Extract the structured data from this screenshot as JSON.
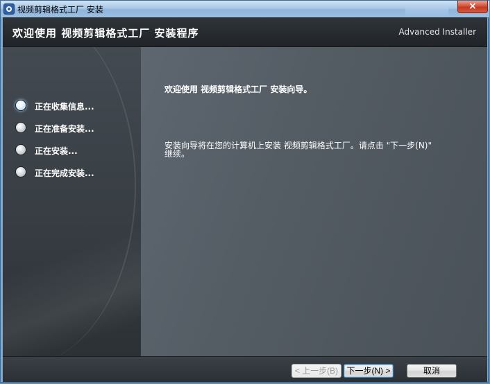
{
  "window": {
    "title": "视频剪辑格式工厂 安装",
    "close_label": "×"
  },
  "header": {
    "title": "欢迎使用 视频剪辑格式工厂 安装程序",
    "brand": "Advanced Installer"
  },
  "steps": [
    {
      "label": "正在收集信息...",
      "active": true
    },
    {
      "label": "正在准备安装...",
      "active": false
    },
    {
      "label": "正在安装...",
      "active": false
    },
    {
      "label": "正在完成安装...",
      "active": false
    }
  ],
  "content": {
    "welcome_title": "欢迎使用 视频剪辑格式工厂 安装向导。",
    "welcome_text": "安装向导将在您的计算机上安装 视频剪辑格式工厂。请点击 \"下一步(N)\" 继续。"
  },
  "footer": {
    "back_label": "< 上一步(B)",
    "next_label": "下一步(N) >",
    "cancel_label": "取消"
  }
}
